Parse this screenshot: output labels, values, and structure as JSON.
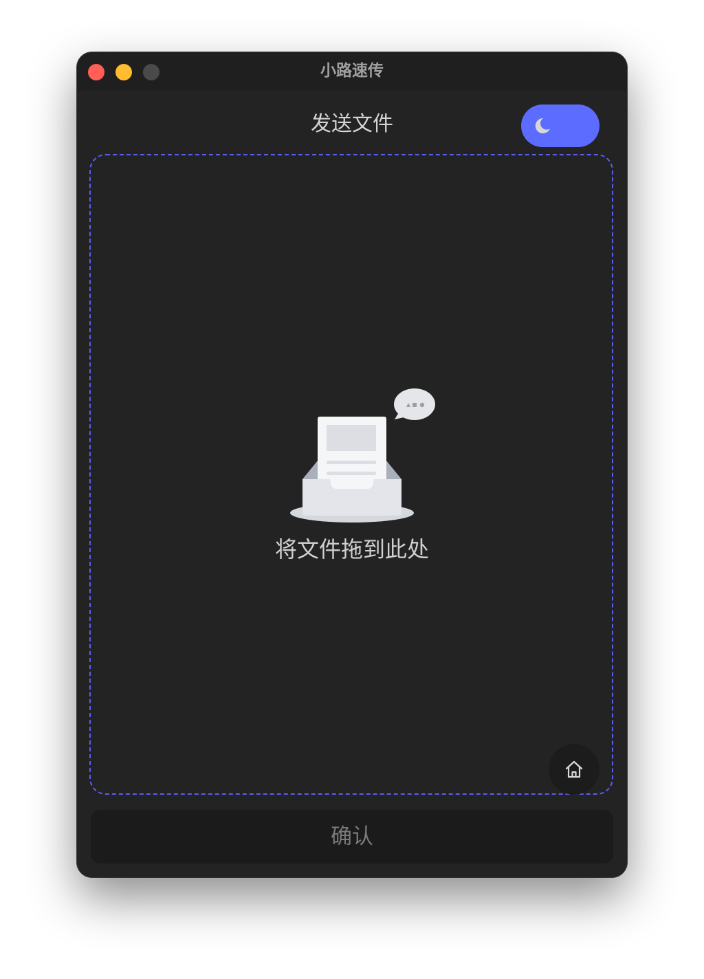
{
  "window": {
    "title": "小路速传",
    "controls": [
      "close",
      "minimize",
      "maximize"
    ]
  },
  "header": {
    "title": "发送文件",
    "theme_toggle": {
      "icon": "moon-icon",
      "mode": "dark",
      "accent": "#5c6cff"
    }
  },
  "dropzone": {
    "hint": "将文件拖到此处",
    "illustration": "document-inbox-icon",
    "border_color": "#5a5ef0"
  },
  "home_button": {
    "icon": "home-icon"
  },
  "footer": {
    "confirm_label": "确认"
  }
}
